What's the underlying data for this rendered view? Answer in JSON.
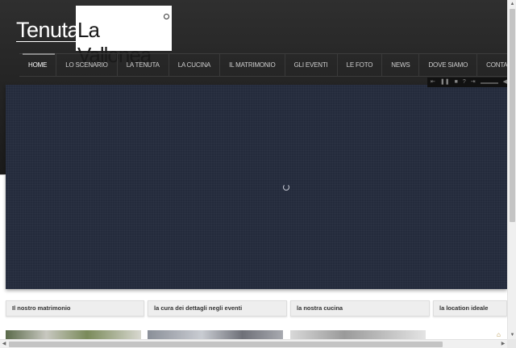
{
  "logo": {
    "tenuta": "Tenuta",
    "vallonea": "La Vallonea"
  },
  "nav": {
    "items": [
      {
        "label": "HOME",
        "active": true
      },
      {
        "label": "LO SCENARIO",
        "active": false
      },
      {
        "label": "LA TENUTA",
        "active": false
      },
      {
        "label": "LA CUCINA",
        "active": false
      },
      {
        "label": "IL MATRIMONIO",
        "active": false
      },
      {
        "label": "GLI EVENTI",
        "active": false
      },
      {
        "label": "LE FOTO",
        "active": false
      },
      {
        "label": "NEWS",
        "active": false
      },
      {
        "label": "DOVE SIAMO",
        "active": false
      },
      {
        "label": "CONTATTI",
        "active": false
      }
    ]
  },
  "slider": {
    "background_color": "#242b3c",
    "controls": [
      "prev-icon",
      "pause-icon",
      "stop-icon",
      "help-icon",
      "next-icon"
    ]
  },
  "tabs": [
    {
      "label": "Il nostro matrimonio"
    },
    {
      "label": "la cura dei dettagli negli eventi"
    },
    {
      "label": "la nostra cucina"
    },
    {
      "label": "la location ideale"
    }
  ],
  "colors": {
    "header_bg": "#262626",
    "nav_text": "#cfcfcf",
    "tab_bg": "#eeeeee"
  }
}
